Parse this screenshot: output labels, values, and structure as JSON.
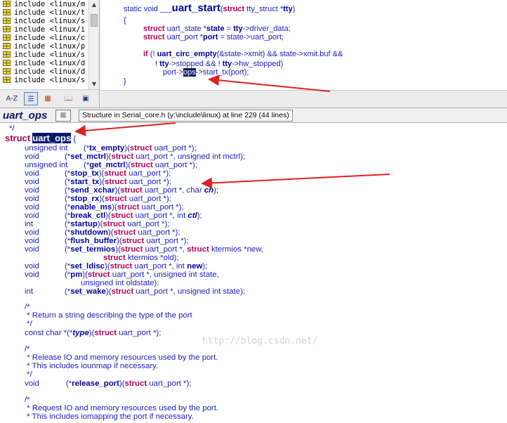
{
  "symbol_list": {
    "rows": [
      "include <linux/m",
      "include <linux/t",
      "include <linux/s",
      "include <linux/i",
      "include <linux/c",
      "include <linux/p",
      "include <linux/s",
      "include <linux/d",
      "include <linux/d",
      "include <linux/s"
    ],
    "toolbar": {
      "sort_label": "A-Z",
      "icons": [
        "list-view-icon",
        "category-view-icon",
        "book-icon",
        "browse-icon"
      ]
    }
  },
  "preview": {
    "line1_prefix": "static void ",
    "line1_fn": "__uart_start",
    "line1_args_kw": "struct",
    "line1_args_rest": " tty_struct *",
    "line1_args_tty": "tty",
    "line1_close": ")",
    "open_brace": "{",
    "decl1_kw": "struct",
    "decl1_rest": " uart_state *",
    "decl1_var": "state",
    "decl1_eq": " = ",
    "decl1_tty": "tty",
    "decl1_tail": "->driver_data;",
    "decl2_kw": "struct",
    "decl2_rest": " uart_port *",
    "decl2_var": "port",
    "decl2_tail": " = state->uart_port;",
    "if_kw": "if",
    "if_mid": " (! ",
    "if_fn": "uart_circ_empty",
    "if_tail": "(&state->xmit) && state->xmit.buf &&",
    "cond_pre": "! ",
    "cond_tty1": "tty",
    "cond_mid": "->stopped && ! ",
    "cond_tty2": "tty",
    "cond_tail": "->hw_stopped)",
    "call_pre": "port->",
    "call_ops": "ops",
    "call_tail": "->start_tx(port);",
    "close_brace": "}"
  },
  "context": {
    "title": "uart_ops",
    "info": "Structure in Serial_core.h (y:\\include\\linux) at line 229 (44 lines)"
  },
  "code": {
    "comment_end": "*/",
    "struct_kw": "struct",
    "struct_name": "uart_ops",
    "open_brace": "{",
    "members": [
      {
        "ret": "unsigned int",
        "name": "tx_empty",
        "args_kw": "struct",
        "args": " uart_port *);"
      },
      {
        "ret": "void",
        "name": "set_mctrl",
        "args_kw": "struct",
        "args": " uart_port *, unsigned int mctrl);"
      },
      {
        "ret": "unsigned int",
        "name": "get_mctrl",
        "args_kw": "struct",
        "args": " uart_port *);"
      },
      {
        "ret": "void",
        "name": "stop_tx",
        "args_kw": "struct",
        "args": " uart_port *);"
      },
      {
        "ret": "void",
        "name": "start_tx",
        "args_kw": "struct",
        "args": " uart_port *);"
      },
      {
        "ret": "void",
        "name": "send_xchar",
        "args_kw": "struct",
        "args": " uart_port *, char ",
        "args_it": "ch",
        "args_end": ");"
      },
      {
        "ret": "void",
        "name": "stop_rx",
        "args_kw": "struct",
        "args": " uart_port *);"
      },
      {
        "ret": "void",
        "name": "enable_ms",
        "args_kw": "struct",
        "args": " uart_port *);"
      },
      {
        "ret": "void",
        "name": "break_ctl",
        "args_kw": "struct",
        "args": " uart_port *, int ",
        "args_it": "ctl",
        "args_end": ");"
      },
      {
        "ret": "int",
        "name": "startup",
        "args_kw": "struct",
        "args": " uart_port *);"
      },
      {
        "ret": "void",
        "name": "shutdown",
        "args_kw": "struct",
        "args": " uart_port *);"
      },
      {
        "ret": "void",
        "name": "flush_buffer",
        "args_kw": "struct",
        "args": " uart_port *);"
      },
      {
        "ret": "void",
        "name": "set_termios",
        "args_kw": "struct",
        "args": " uart_port *, ",
        "args_kw2": "struct",
        "args_end": " ktermios *new,"
      },
      {
        "cont": "ktermios *old);"
      },
      {
        "ret": "void",
        "name": "set_ldisc",
        "args_kw": "struct",
        "args": " uart_port *, int ",
        "args_bold": "new",
        "args_end": ");"
      },
      {
        "ret": "void",
        "name": "pm",
        "args_kw": "struct",
        "args": " uart_port *, unsigned int state,"
      },
      {
        "cont2": "unsigned int oldstate);"
      },
      {
        "ret": "int",
        "name": "set_wake",
        "args_kw": "struct",
        "args": " uart_port *, unsigned int state);"
      }
    ],
    "comment1": [
      "/*",
      " * Return a string describing the type of the port",
      " */"
    ],
    "type_line": {
      "ret": "const char *(*",
      "name": "type",
      "mid": ")(",
      "kw": "struct",
      "tail": " uart_port *);"
    },
    "comment2": [
      "/*",
      " * Release IO and memory resources used by the port.",
      " * This includes iounmap if necessary.",
      " */"
    ],
    "release_line": {
      "ret": "void",
      "name": "release_port",
      "kw": "struct",
      "tail": " uart_port *);"
    },
    "comment3": [
      "/*",
      " * Request IO and memory resources used by the port.",
      " * This includes iomapping the port if necessary."
    ]
  },
  "watermark": "http://blog.csdn.net/",
  "colors": {
    "keyword": "#b0005a",
    "function": "#0000a0",
    "text": "#2020c0",
    "highlight_bg": "#0a1a6a",
    "arrow": "#e02020"
  }
}
